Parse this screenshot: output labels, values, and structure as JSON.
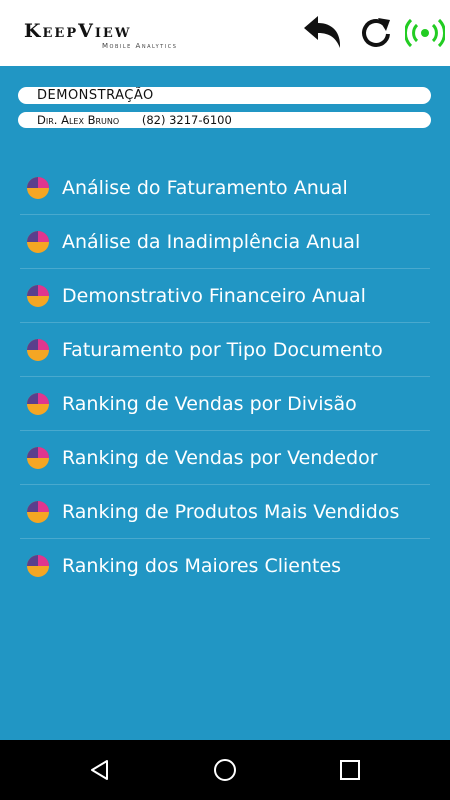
{
  "header": {
    "brand_name": "KeepView",
    "brand_tagline": "Mobile Analytics",
    "icons": [
      "undo-icon",
      "refresh-icon",
      "broadcast-icon"
    ],
    "status_color": "#22cc22"
  },
  "company": {
    "name": "DEMONSTRAÇÃO",
    "contact": "Dir. Alex Bruno",
    "phone": "(82) 3217-6100"
  },
  "menu": {
    "icon": "pie-chart-icon",
    "items": [
      {
        "label": "Análise do Faturamento Anual"
      },
      {
        "label": "Análise da Inadimplência Anual"
      },
      {
        "label": "Demonstrativo Financeiro Anual"
      },
      {
        "label": "Faturamento por Tipo Documento"
      },
      {
        "label": "Ranking de Vendas por Divisão"
      },
      {
        "label": "Ranking de Vendas por Vendedor"
      },
      {
        "label": "Ranking de Produtos Mais Vendidos"
      },
      {
        "label": "Ranking dos Maiores Clientes"
      }
    ]
  },
  "theme": {
    "background": "#2196c4",
    "pie_colors": [
      "#f5a623",
      "#5b3f8c",
      "#e0368f"
    ]
  },
  "system_nav": [
    "back-icon",
    "home-icon",
    "recents-icon"
  ]
}
